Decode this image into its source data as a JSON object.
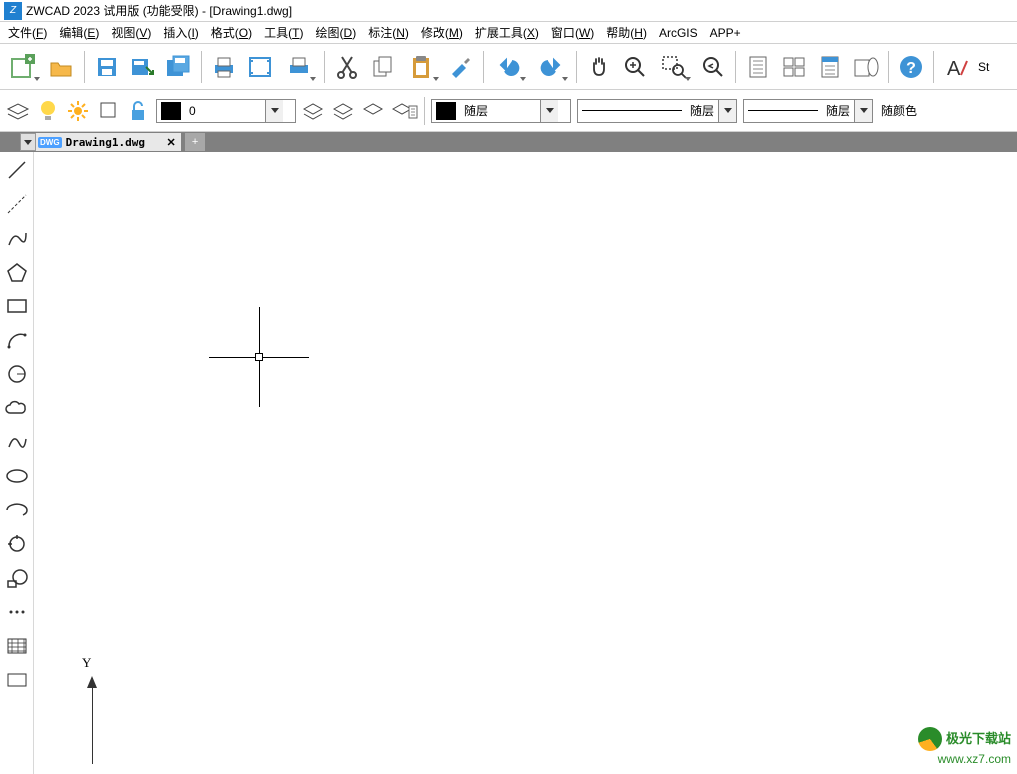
{
  "app": {
    "title": "ZWCAD 2023 试用版 (功能受限) - [Drawing1.dwg]"
  },
  "menu": {
    "items": [
      {
        "label": "文件",
        "accel": "F"
      },
      {
        "label": "编辑",
        "accel": "E"
      },
      {
        "label": "视图",
        "accel": "V"
      },
      {
        "label": "插入",
        "accel": "I"
      },
      {
        "label": "格式",
        "accel": "O"
      },
      {
        "label": "工具",
        "accel": "T"
      },
      {
        "label": "绘图",
        "accel": "D"
      },
      {
        "label": "标注",
        "accel": "N"
      },
      {
        "label": "修改",
        "accel": "M"
      },
      {
        "label": "扩展工具",
        "accel": "X"
      },
      {
        "label": "窗口",
        "accel": "W"
      },
      {
        "label": "帮助",
        "accel": "H"
      },
      {
        "label": "ArcGIS",
        "accel": ""
      },
      {
        "label": "APP+",
        "accel": ""
      }
    ]
  },
  "toolbar": {
    "truncated_label": "St"
  },
  "layer": {
    "current_value": "0"
  },
  "props": {
    "color_label": "随层",
    "linetype_label": "随层",
    "lineweight_label": "随层",
    "plot_style_label": "随颜色"
  },
  "doc_tab": {
    "active_name": "Drawing1.dwg",
    "badge": "DWG",
    "close": "✕",
    "new": "+"
  },
  "ucs": {
    "y": "Y"
  },
  "watermark": {
    "line1": "极光下载站",
    "line2": "www.xz7.com"
  }
}
